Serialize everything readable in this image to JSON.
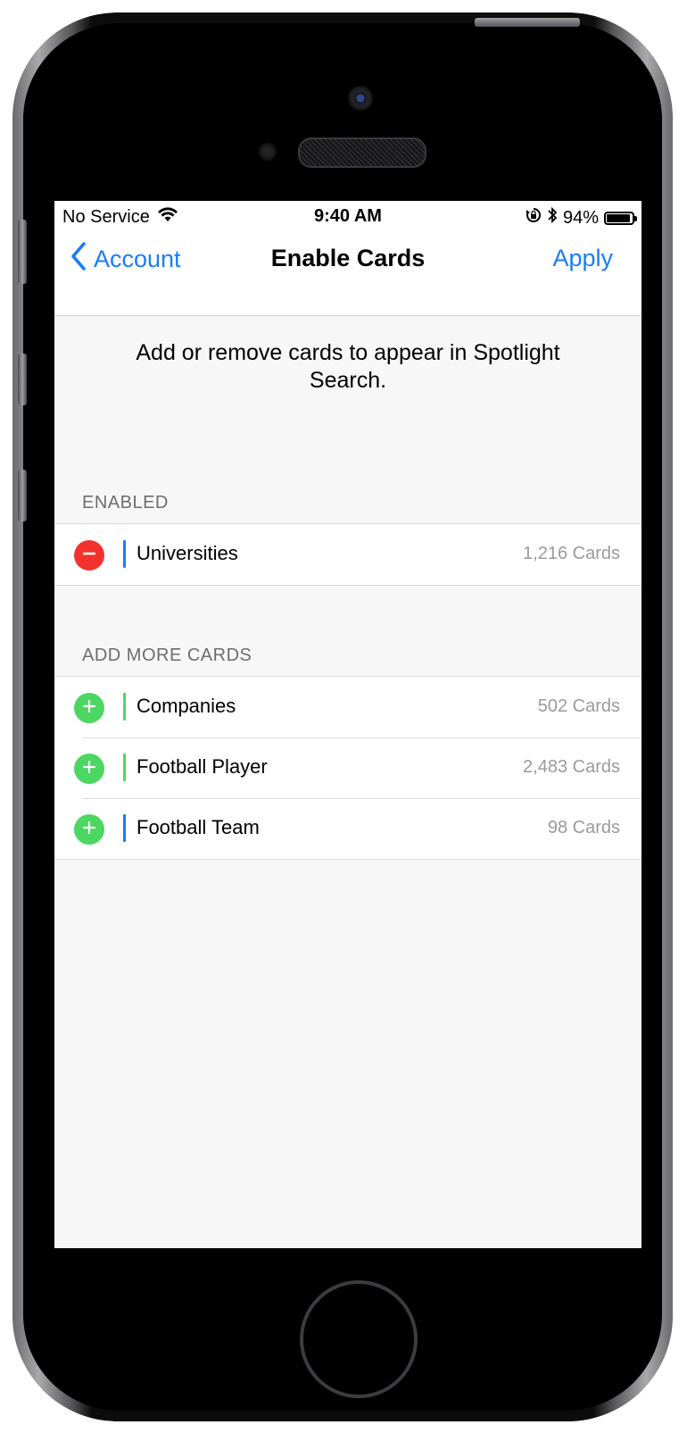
{
  "status_bar": {
    "carrier": "No Service",
    "time": "9:40 AM",
    "battery_percent": "94%",
    "battery_level": 0.94
  },
  "nav": {
    "back_label": "Account",
    "title": "Enable Cards",
    "action_label": "Apply"
  },
  "intro_text": "Add or remove cards to appear in Spotlight Search.",
  "sections": {
    "enabled": {
      "header": "ENABLED",
      "items": [
        {
          "label": "Universities",
          "count": "1,216 Cards",
          "accent": "#1a7cf7",
          "action": "remove"
        }
      ]
    },
    "add_more": {
      "header": "ADD MORE CARDS",
      "items": [
        {
          "label": "Companies",
          "count": "502 Cards",
          "accent": "#4bd762",
          "action": "add"
        },
        {
          "label": "Football Player",
          "count": "2,483 Cards",
          "accent": "#4bd762",
          "action": "add"
        },
        {
          "label": "Football Team",
          "count": "98 Cards",
          "accent": "#1a7cf7",
          "action": "add"
        }
      ]
    }
  },
  "colors": {
    "ios_blue": "#1a7cf7",
    "remove_red": "#f4322d",
    "add_green": "#4bd762",
    "background": "#f7f7f7"
  }
}
